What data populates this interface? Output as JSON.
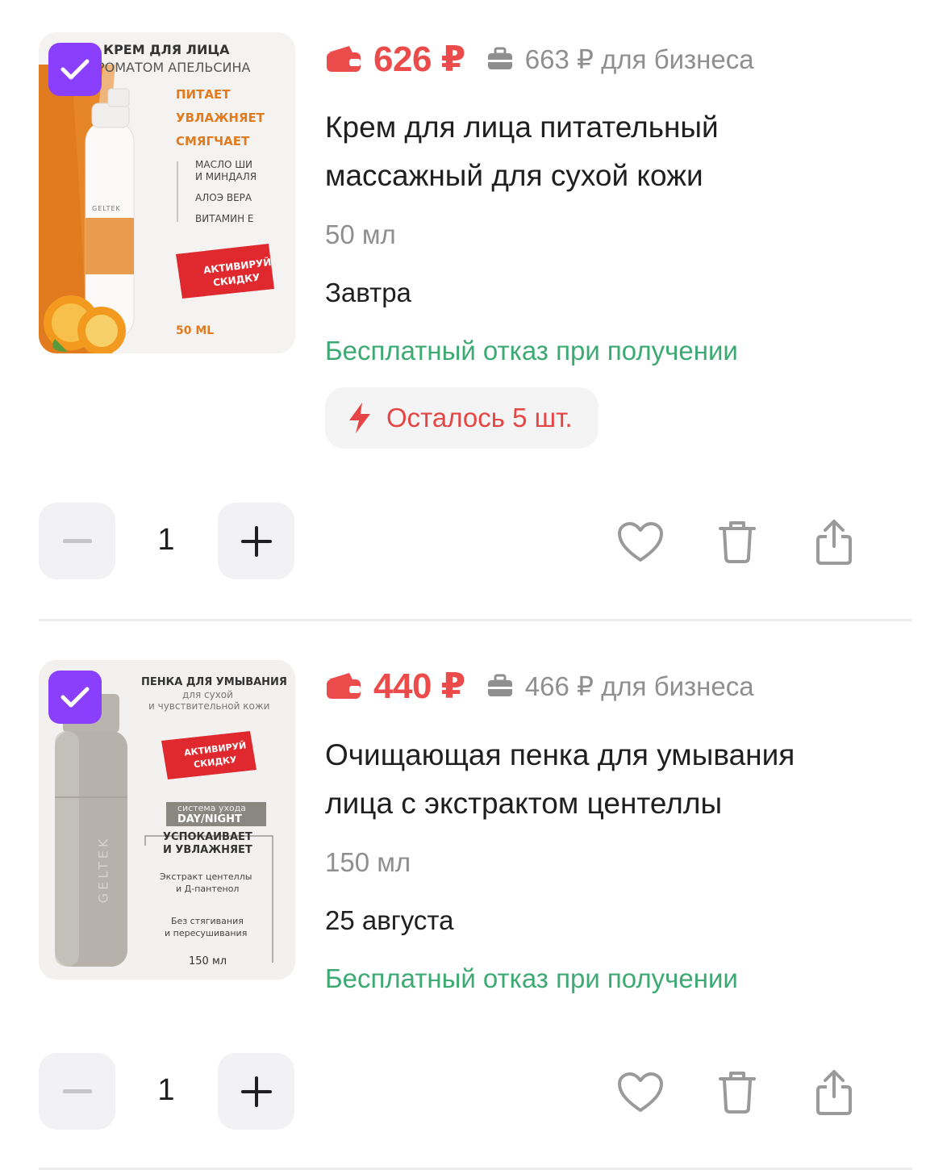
{
  "cart": {
    "items": [
      {
        "selected": true,
        "price": "626 ₽",
        "business_price": "663 ₽ для бизнеса",
        "title_line1": "Крем для лица питательный",
        "title_line2": "массажный для сухой кожи",
        "size": "50 мл",
        "delivery": "Завтра",
        "refund": "Бесплатный отказ при получении",
        "stock": "Осталось 5 шт.",
        "quantity": "1",
        "image_text": {
          "headline1": "КРЕМ ДЛЯ ЛИЦА",
          "headline2": "РОМАТОМ АПЕЛЬСИНА",
          "benefit1": "ПИТАЕТ",
          "benefit2": "УВЛАЖНЯЕТ",
          "benefit3": "СМЯГЧАЕТ",
          "ingredient1a": "МАСЛО ШИ",
          "ingredient1b": "И МИНДАЛЯ",
          "ingredient2": "АЛОЭ ВЕРА",
          "ingredient3": "ВИТАМИН Е",
          "promo1": "АКТИВИРУЙ",
          "promo2": "СКИДКУ",
          "volume": "50 ML",
          "brand": "GELTEK"
        }
      },
      {
        "selected": true,
        "price": "440 ₽",
        "business_price": "466 ₽ для бизнеса",
        "title_line1": "Очищающая пенка для умывания",
        "title_line2": "лица с экстрактом центеллы",
        "size": "150 мл",
        "delivery": "25 августа",
        "refund": "Бесплатный отказ при получении",
        "quantity": "1",
        "image_text": {
          "headline1": "ПЕНКА ДЛЯ УМЫВАНИЯ",
          "headline2": "для сухой",
          "headline3": "и чувствительной кожи",
          "promo1": "АКТИВИРУЙ",
          "promo2": "СКИДКУ",
          "system": "система ухода",
          "daynight": "DAY/NIGHT",
          "claim1": "УСПОКАИВАЕТ",
          "claim2": "И УВЛАЖНЯЕТ",
          "ingr1": "Экстракт центеллы",
          "ingr2": "и Д-пантенол",
          "note1": "Без стягивания",
          "note2": "и пересушивания",
          "volume": "150 мл",
          "brand": "GELTEK"
        }
      }
    ]
  },
  "colors": {
    "price": "#ec4b4b",
    "refund": "#3daa73",
    "checkbox": "#8a3ffc",
    "muted": "#8f8f8f"
  },
  "icons": [
    "wallet-icon",
    "briefcase-icon",
    "lightning-icon",
    "minus-icon",
    "plus-icon",
    "heart-icon",
    "trash-icon",
    "share-icon",
    "checkmark-icon"
  ]
}
